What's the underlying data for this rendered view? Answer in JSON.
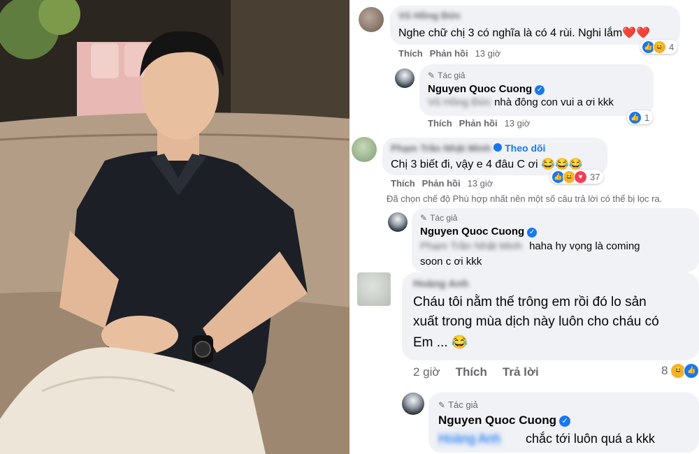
{
  "comments": [
    {
      "name": "Vũ Hồng Đức",
      "text": "Nghe chữ chị 3 có nghĩa là có 4 rùi. Nghi lắm❤️❤️",
      "actions": {
        "like": "Thích",
        "reply": "Phản hồi",
        "time": "13 giờ"
      },
      "reactions": {
        "icons": [
          "like-icon",
          "haha-icon"
        ],
        "count": "4"
      },
      "reply": {
        "author_tag": "Tác giả",
        "name": "Nguyen Quoc Cuong",
        "mention": "Vũ Hồng Đức",
        "text": "nhà đông con vui a ơi kkk",
        "actions": {
          "like": "Thích",
          "reply": "Phản hồi",
          "time": "13 giờ"
        },
        "reactions": {
          "icons": [
            "like-icon"
          ],
          "count": "1"
        }
      }
    },
    {
      "name": "Phạm Trần Nhật Minh",
      "follow": "Theo dõi",
      "text": "Chị 3 biết đi, vậy e 4 đâu C ơi 😂😂😂",
      "actions": {
        "like": "Thích",
        "reply": "Phản hồi",
        "time": "13 giờ"
      },
      "reactions": {
        "icons": [
          "like-icon",
          "haha-icon",
          "love-icon"
        ],
        "count": "37"
      },
      "notice": "Đã chọn chế độ Phù hợp nhất nên một số câu trả lời có thể bị lọc ra.",
      "reply": {
        "author_tag": "Tác giả",
        "name": "Nguyen Quoc Cuong",
        "mention": "Phạm Trần Nhật Minh",
        "text_line1": "haha hy vọng là coming",
        "text_line2": "soon c ơi kkk"
      }
    },
    {
      "name": "Hoàng Anh",
      "text_line1": "Cháu tôi nằm thế trông em rồi đó lo sản",
      "text_line2": "xuất trong mùa dịch này luôn cho cháu có",
      "text_line3": "Em ... 😂",
      "actions": {
        "time": "2 giờ",
        "like": "Thích",
        "reply": "Trả lời"
      },
      "reactions": {
        "count": "8",
        "icons": [
          "haha-icon",
          "like-icon"
        ]
      },
      "reply": {
        "author_tag": "Tác giả",
        "name": "Nguyen Quoc Cuong",
        "mention": "Hoàng Anh",
        "text": "chắc tới luôn quá a kkk"
      }
    }
  ],
  "colors": {
    "link": "#1877f2",
    "bubble": "#f0f2f5",
    "muted": "#65676b"
  }
}
